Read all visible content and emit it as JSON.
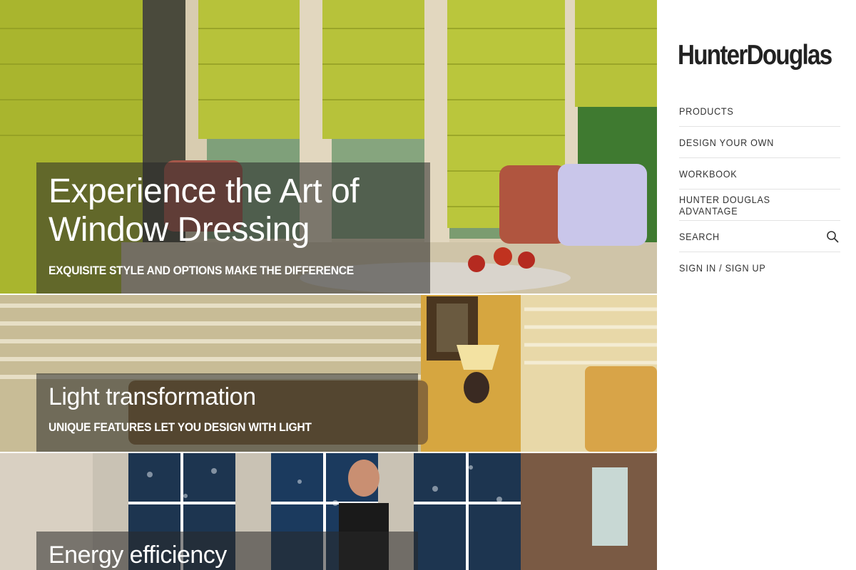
{
  "brand": {
    "logo_text": "HunterDouglas"
  },
  "nav": {
    "items": [
      {
        "label": "PRODUCTS"
      },
      {
        "label": "DESIGN YOUR OWN"
      },
      {
        "label": "WORKBOOK"
      },
      {
        "label": "HUNTER DOUGLAS ADVANTAGE"
      },
      {
        "label": "SEARCH",
        "icon": "search-icon"
      },
      {
        "label": "SIGN IN / SIGN UP"
      }
    ]
  },
  "panels": [
    {
      "headline_line1": "Experience the Art of",
      "headline_line2": "Window Dressing",
      "subhead": "EXQUISITE STYLE AND OPTIONS MAKE THE DIFFERENCE"
    },
    {
      "headline": "Light transformation",
      "subhead": "UNIQUE FEATURES LET YOU DESIGN WITH LIGHT"
    },
    {
      "headline": "Energy efficiency"
    }
  ],
  "colors": {
    "accent_shade": "#b7c23a",
    "overlay": "rgba(40,40,40,0.55)",
    "text_dark": "#333333"
  }
}
